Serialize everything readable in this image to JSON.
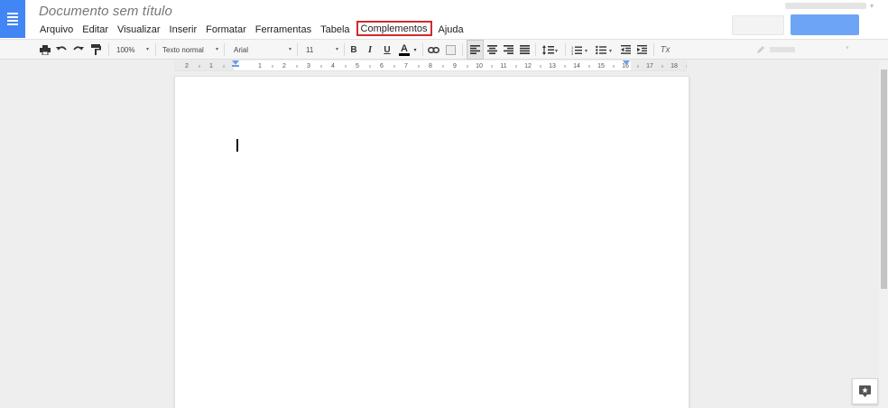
{
  "document": {
    "title": "Documento sem título"
  },
  "menu": {
    "items": [
      "Arquivo",
      "Editar",
      "Visualizar",
      "Inserir",
      "Formatar",
      "Ferramentas",
      "Tabela",
      "Complementos",
      "Ajuda"
    ],
    "highlighted": "Complementos"
  },
  "toolbar": {
    "zoom": "100%",
    "style": "Texto normal",
    "font": "Arial",
    "font_size": "11",
    "bold_label": "B",
    "italic_label": "I",
    "underline_label": "U",
    "text_color_label": "A",
    "clear_format_label": "Tx"
  },
  "ruler": {
    "ticks": [
      "2",
      "1",
      "1",
      "2",
      "3",
      "4",
      "5",
      "6",
      "7",
      "8",
      "9",
      "10",
      "11",
      "12",
      "13",
      "14",
      "15",
      "16",
      "17",
      "18"
    ]
  },
  "colors": {
    "brand_blue": "#4285f4",
    "highlight_border": "#d02b2b"
  },
  "icons": [
    "print-icon",
    "undo-icon",
    "redo-icon",
    "paint-format-icon",
    "link-icon",
    "comment-icon",
    "align-left-icon",
    "align-center-icon",
    "align-right-icon",
    "justify-icon",
    "line-spacing-icon",
    "numbered-list-icon",
    "bulleted-list-icon",
    "decrease-indent-icon",
    "increase-indent-icon",
    "clear-formatting-icon",
    "explore-icon"
  ]
}
